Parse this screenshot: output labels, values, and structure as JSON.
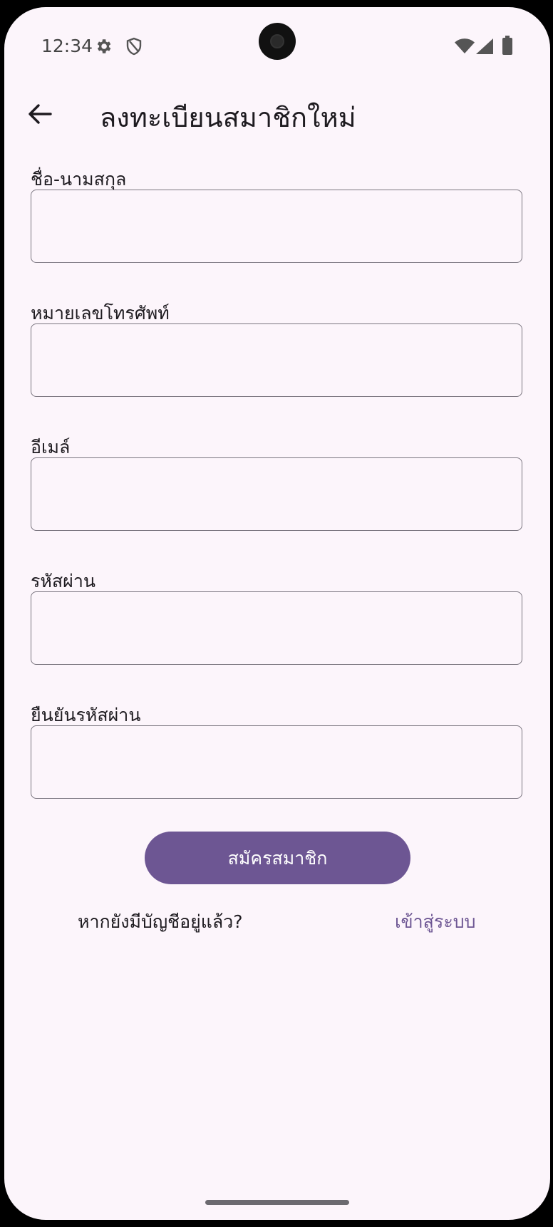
{
  "status_bar": {
    "time": "12:34",
    "icons": [
      "gear-icon",
      "shield-icon",
      "wifi-icon",
      "signal-icon",
      "battery-icon"
    ]
  },
  "header": {
    "title": "ลงทะเบียนสมาชิกใหม่",
    "back_icon": "arrow-left-icon"
  },
  "form": {
    "fields": [
      {
        "label": "ชื่อ-นามสกุล",
        "value": "",
        "placeholder": ""
      },
      {
        "label": "หมายเลขโทรศัพท์",
        "value": "",
        "placeholder": ""
      },
      {
        "label": "อีเมล์",
        "value": "",
        "placeholder": ""
      },
      {
        "label": "รหัสผ่าน",
        "value": "",
        "placeholder": ""
      },
      {
        "label": "ยืนยันรหัสผ่าน",
        "value": "",
        "placeholder": ""
      }
    ],
    "submit_label": "สมัครสมาชิก"
  },
  "footer": {
    "prompt": "หากยังมีบัญชีอยู่แล้ว?",
    "login_link": "เข้าสู่ระบบ"
  },
  "colors": {
    "background": "#fcf5fb",
    "accent": "#6d5693",
    "text": "#1e1b20",
    "outline": "#7a757f"
  }
}
